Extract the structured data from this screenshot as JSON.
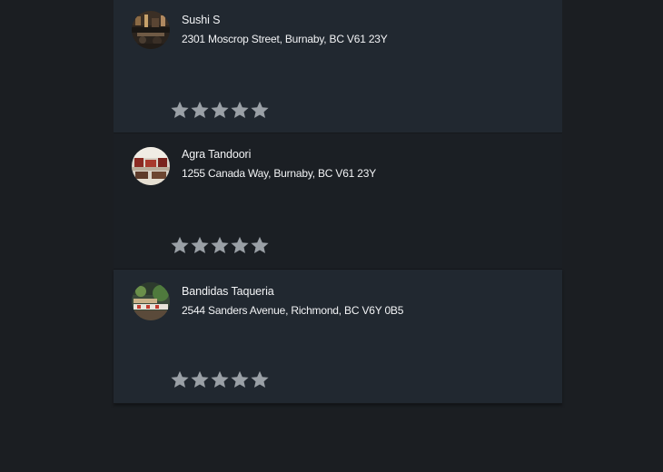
{
  "restaurants": [
    {
      "name": "Sushi S",
      "address": "2301 Moscrop Street, Burnaby, BC V61 23Y",
      "rating": 0,
      "max_rating": 5,
      "thumbnail": "restaurant-photo"
    },
    {
      "name": "Agra Tandoori",
      "address": "1255 Canada Way, Burnaby, BC V61 23Y",
      "rating": 0,
      "max_rating": 5,
      "thumbnail": "restaurant-photo"
    },
    {
      "name": "Bandidas Taqueria",
      "address": "2544 Sanders Avenue, Richmond, BC V6Y 0B5",
      "rating": 0,
      "max_rating": 5,
      "thumbnail": "restaurant-photo"
    }
  ],
  "colors": {
    "page_background": "#1b1e22",
    "card_background": "#212830",
    "card_background_alt": "#1b1f24",
    "text": "#f2f3f5",
    "star_empty": "#9aa0a6"
  }
}
